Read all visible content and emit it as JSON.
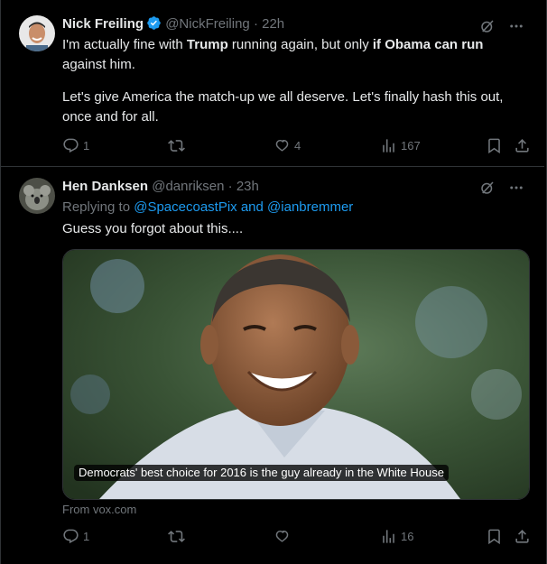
{
  "tweets": [
    {
      "author_name": "Nick Freiling",
      "handle": "@NickFreiling",
      "dot": "·",
      "time": "22h",
      "verified": true,
      "text_part1": "I'm actually fine with ",
      "text_bold1": "Trump",
      "text_part2": " running again, but only ",
      "text_bold2": "if Obama can run",
      "text_part3": "against him.",
      "paragraph2": "Let's give America the match-up we all deserve. Let's finally hash this out, once and for all.",
      "reply_count": "1",
      "retweet_count": "",
      "like_count": "4",
      "view_count": "167"
    },
    {
      "author_name": "Hen Danksen",
      "handle": "@danriksen",
      "dot": "·",
      "time": "23h",
      "replying_prefix": "Replying to ",
      "replying_user1": "@SpacecoastPix",
      "replying_and": " and ",
      "replying_user2": "@ianbremmer",
      "text": "Guess you forgot about this....",
      "media_caption": "Democrats' best choice for 2016 is the guy already in the White House",
      "source": "From vox.com",
      "reply_count": "1",
      "retweet_count": "",
      "like_count": "",
      "view_count": "16"
    }
  ],
  "colors": {
    "background": "#000000",
    "text": "#e7e9ea",
    "muted": "#71767b",
    "link": "#1d9bf0",
    "border": "#2f3336",
    "verified": "#1d9bf0"
  },
  "icons": [
    "verified-badge-icon",
    "grok-icon",
    "more-icon",
    "reply-icon",
    "retweet-icon",
    "like-icon",
    "views-icon",
    "bookmark-icon",
    "share-icon"
  ]
}
